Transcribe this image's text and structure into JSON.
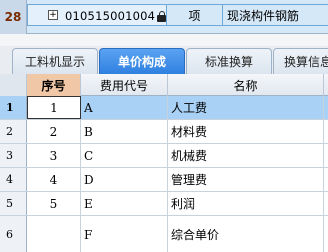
{
  "top_row": {
    "index": "28",
    "expand_symbol": "+",
    "code": "010515001004",
    "unit": "项",
    "name": "现浇构件钢筋"
  },
  "tabs": [
    {
      "label": "工料机显示",
      "active": false
    },
    {
      "label": "单价构成",
      "active": true
    },
    {
      "label": "标准换算",
      "active": false
    },
    {
      "label": "换算信息",
      "active": false
    }
  ],
  "grid": {
    "headers": {
      "seq": "序号",
      "code": "费用代号",
      "name": "名称"
    },
    "rows": [
      {
        "index": "1",
        "seq": "1",
        "code": "A",
        "name": "人工费"
      },
      {
        "index": "2",
        "seq": "2",
        "code": "B",
        "name": "材料费"
      },
      {
        "index": "3",
        "seq": "3",
        "code": "C",
        "name": "机械费"
      },
      {
        "index": "4",
        "seq": "4",
        "code": "D",
        "name": "管理费"
      },
      {
        "index": "5",
        "seq": "5",
        "code": "E",
        "name": "利润"
      },
      {
        "index": "6",
        "seq": "",
        "code": "F",
        "name": "综合单价"
      }
    ]
  },
  "colors": {
    "active_tab": "#2f80e0",
    "selected_row": "#a9d0f5",
    "seq_header": "#f0c8a8"
  }
}
